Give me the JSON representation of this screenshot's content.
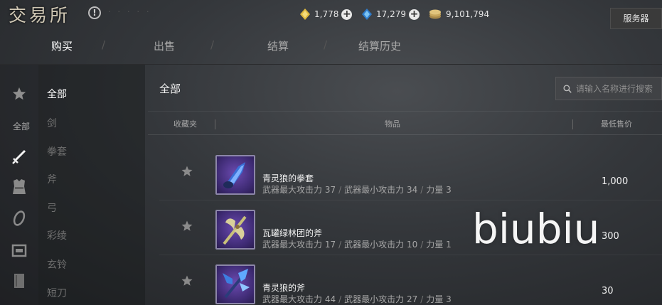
{
  "header": {
    "title": "交易所",
    "help_icon": "info-icon",
    "currencies": [
      {
        "icon": "gold-crystal-icon",
        "value": "1,778"
      },
      {
        "icon": "blue-crystal-icon",
        "value": "17,279"
      },
      {
        "icon": "coin-stack-icon",
        "value": "9,101,794"
      }
    ],
    "server_label": "服务器"
  },
  "tabs": [
    {
      "label": "购买",
      "active": true
    },
    {
      "label": "出售",
      "active": false
    },
    {
      "label": "结算",
      "active": false
    },
    {
      "label": "结算历史",
      "active": false
    }
  ],
  "rail": {
    "all_label": "全部",
    "icons": [
      "star-icon",
      "sword-icon",
      "armor-icon",
      "accessory-icon",
      "box-icon",
      "book-icon"
    ]
  },
  "categories": [
    {
      "label": "全部",
      "active": true
    },
    {
      "label": "剑",
      "active": false
    },
    {
      "label": "拳套",
      "active": false
    },
    {
      "label": "斧",
      "active": false
    },
    {
      "label": "弓",
      "active": false
    },
    {
      "label": "彩绫",
      "active": false
    },
    {
      "label": "玄铃",
      "active": false
    },
    {
      "label": "短刀",
      "active": false
    }
  ],
  "main": {
    "title": "全部",
    "search_placeholder": "请输入名称进行搜索",
    "columns": {
      "fav": "收藏夹",
      "item": "物品",
      "price": "最低售价"
    }
  },
  "items": [
    {
      "name": "青灵狼的拳套",
      "stats": [
        "武器最大攻击力 37",
        "武器最小攻击力 34",
        "力量 3"
      ],
      "price": "1,000",
      "icon": "claw-gauntlet-icon"
    },
    {
      "name": "瓦罐绿林团的斧",
      "stats": [
        "武器最大攻击力 17",
        "武器最小攻击力 10",
        "力量 1"
      ],
      "price": "300",
      "icon": "battle-axe-icon"
    },
    {
      "name": "青灵狼的斧",
      "stats": [
        "武器最大攻击力 44",
        "武器最小攻击力 27",
        "力量 3"
      ],
      "price": "30",
      "icon": "crystal-axe-icon"
    }
  ],
  "watermark": "biubiu",
  "colors": {
    "accent_gold": "#e0b93e",
    "accent_blue": "#4aa3e6",
    "thumb_purple": "#5b3da0"
  }
}
